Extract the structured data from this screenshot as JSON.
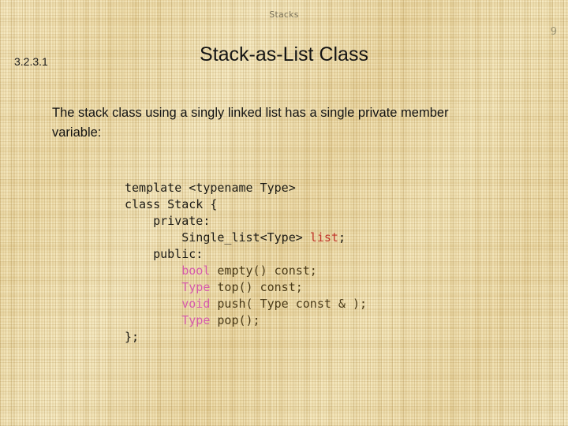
{
  "header": {
    "deck_title": "Stacks",
    "page_number": "9"
  },
  "title_row": {
    "section_number": "3.2.3.1",
    "slide_title": "Stack-as-List Class"
  },
  "body": {
    "paragraph": "The stack class using a singly linked list has a single private member variable:"
  },
  "code": {
    "lines": [
      {
        "id": "line-template",
        "tokens": [
          {
            "text": "template <typename Type>",
            "style": "plain"
          }
        ]
      },
      {
        "id": "line-class-decl",
        "tokens": [
          {
            "text": "class Stack {",
            "style": "plain"
          }
        ]
      },
      {
        "id": "line-private",
        "tokens": [
          {
            "text": "    private:",
            "style": "plain"
          }
        ]
      },
      {
        "id": "line-member-list",
        "tokens": [
          {
            "text": "        Single_list<Type> ",
            "style": "plain"
          },
          {
            "text": "list",
            "style": "var"
          },
          {
            "text": ";",
            "style": "plain"
          }
        ]
      },
      {
        "id": "line-public",
        "tokens": [
          {
            "text": "    public:",
            "style": "plain"
          }
        ]
      },
      {
        "id": "line-empty",
        "tokens": [
          {
            "text": "        ",
            "style": "plain"
          },
          {
            "text": "bool",
            "style": "type"
          },
          {
            "text": " empty() const;",
            "style": "dim"
          }
        ]
      },
      {
        "id": "line-top",
        "tokens": [
          {
            "text": "        ",
            "style": "plain"
          },
          {
            "text": "Type",
            "style": "type"
          },
          {
            "text": " top() const;",
            "style": "dim"
          }
        ]
      },
      {
        "id": "line-push",
        "tokens": [
          {
            "text": "        ",
            "style": "plain"
          },
          {
            "text": "void",
            "style": "type"
          },
          {
            "text": " push( Type const & );",
            "style": "dim"
          }
        ]
      },
      {
        "id": "line-pop",
        "tokens": [
          {
            "text": "        ",
            "style": "plain"
          },
          {
            "text": "Type",
            "style": "type"
          },
          {
            "text": " pop();",
            "style": "dim"
          }
        ]
      },
      {
        "id": "line-close",
        "tokens": [
          {
            "text": "};",
            "style": "plain"
          }
        ]
      }
    ]
  },
  "colors": {
    "background": "#EBD9A4",
    "header_text": "#7A7158",
    "page_number": "#9C9473",
    "title": "#141414",
    "body_text": "#121212",
    "code_default": "#4A3A18",
    "code_type_keyword": "#D65BAC",
    "code_variable": "#C0342A"
  }
}
